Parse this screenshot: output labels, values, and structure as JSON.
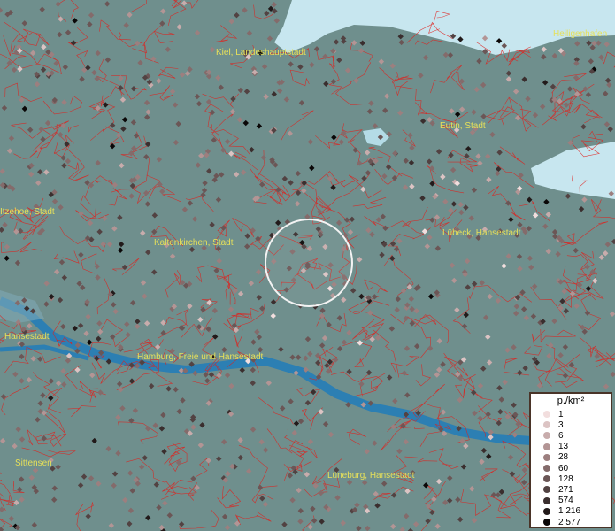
{
  "places": [
    {
      "id": "kiel",
      "name": "Kiel, Landeshauptstadt"
    },
    {
      "id": "heiligenhafen",
      "name": "Heiligenhafen"
    },
    {
      "id": "eutin",
      "name": "Eutin, Stadt"
    },
    {
      "id": "itzehoe",
      "name": "Itzehoe, Stadt"
    },
    {
      "id": "kaltenkirchen",
      "name": "Kaltenkirchen, Stadt"
    },
    {
      "id": "luebeck",
      "name": "Lübeck, Hansestadt"
    },
    {
      "id": "hansestadt",
      "name": "Hansestadt"
    },
    {
      "id": "hamburg",
      "name": "Hamburg, Freie und Hansestadt"
    },
    {
      "id": "stelle",
      "name": "Sittensen"
    },
    {
      "id": "lueneburg",
      "name": "Lüneburg, Hansestadt"
    }
  ],
  "legend": {
    "title": "p./km²",
    "entries": [
      {
        "value": "1",
        "color": "#f2dede"
      },
      {
        "value": "3",
        "color": "#dcc4c4"
      },
      {
        "value": "6",
        "color": "#c8acac"
      },
      {
        "value": "13",
        "color": "#b39595"
      },
      {
        "value": "28",
        "color": "#9c7f7f"
      },
      {
        "value": "60",
        "color": "#846b6b"
      },
      {
        "value": "128",
        "color": "#6b5656"
      },
      {
        "value": "271",
        "color": "#524242"
      },
      {
        "value": "574",
        "color": "#3a2e2e"
      },
      {
        "value": "1 216",
        "color": "#221a1a"
      },
      {
        "value": "2 577",
        "color": "#0a0707"
      }
    ]
  },
  "colors": {
    "land": "#6f8f8d",
    "water": "#bfe3ee",
    "river": "#2e7fb0",
    "boundary": "#e0201c",
    "label": "#e6e05a"
  }
}
